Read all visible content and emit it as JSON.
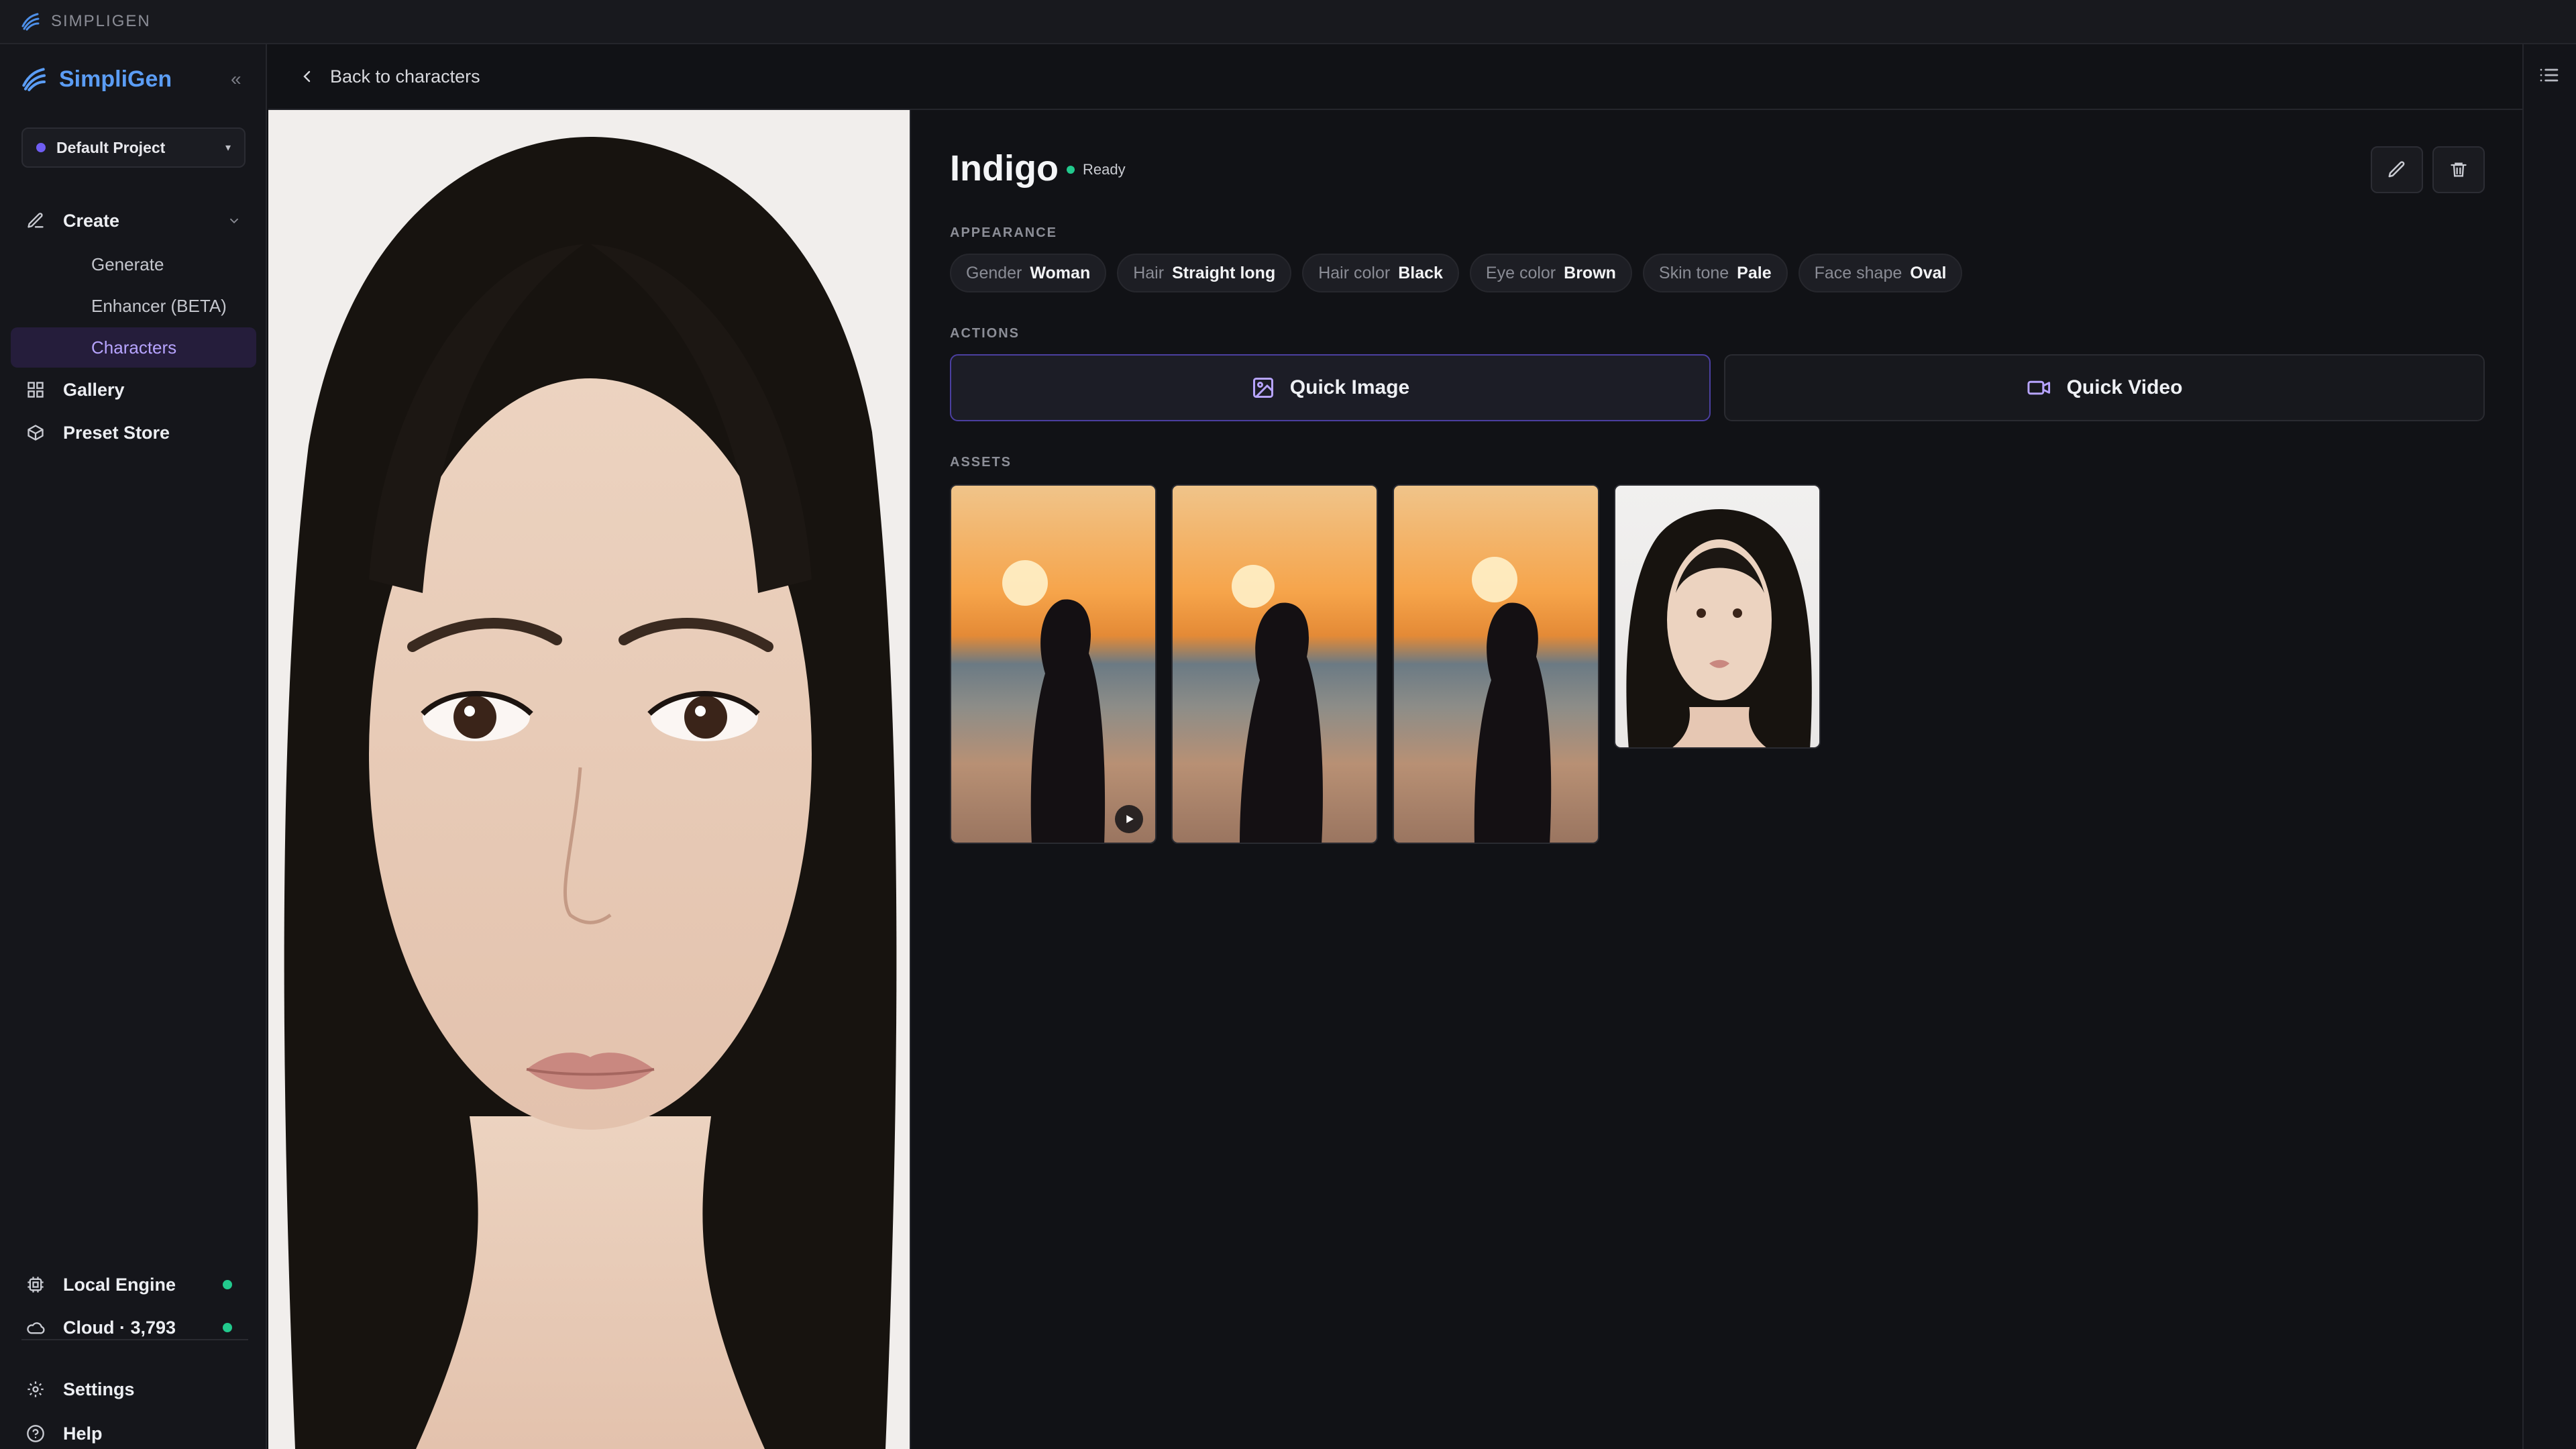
{
  "titlebar": {
    "app_label": "SIMPLIGEN"
  },
  "sidebar": {
    "brand": "SimpliGen",
    "collapse_glyph": "«",
    "project": {
      "label": "Default Project",
      "caret": "▾"
    },
    "create_label": "Create",
    "create_items": [
      {
        "label": "Generate",
        "active": false
      },
      {
        "label": "Enhancer (BETA)",
        "active": false
      },
      {
        "label": "Characters",
        "active": true
      }
    ],
    "gallery_label": "Gallery",
    "preset_store_label": "Preset Store",
    "local_engine_label": "Local Engine",
    "cloud_label": "Cloud · 3,793",
    "settings_label": "Settings",
    "help_label": "Help",
    "status_color": "#22c98d",
    "accent_color": "#b7a4ff"
  },
  "topbar": {
    "back_label": "Back to characters"
  },
  "character": {
    "name": "Indigo",
    "status": "Ready"
  },
  "appearance": {
    "heading": "APPEARANCE",
    "chips": [
      {
        "key": "Gender",
        "value": "Woman"
      },
      {
        "key": "Hair",
        "value": "Straight long"
      },
      {
        "key": "Hair color",
        "value": "Black"
      },
      {
        "key": "Eye color",
        "value": "Brown"
      },
      {
        "key": "Skin tone",
        "value": "Pale"
      },
      {
        "key": "Face shape",
        "value": "Oval"
      }
    ]
  },
  "actions": {
    "heading": "ACTIONS",
    "quick_image": "Quick Image",
    "quick_video": "Quick Video"
  },
  "assets": {
    "heading": "ASSETS",
    "items": [
      {
        "kind": "video",
        "scene": "sunset beach"
      },
      {
        "kind": "image",
        "scene": "sunset beach"
      },
      {
        "kind": "image",
        "scene": "sunset beach"
      },
      {
        "kind": "image",
        "scene": "studio portrait"
      }
    ]
  }
}
